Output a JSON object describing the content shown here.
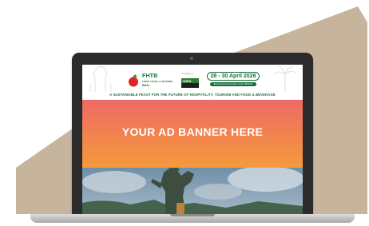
{
  "colors": {
    "background_shape": "#c7b49c",
    "laptop_frame": "#2b2b2d",
    "brand_green": "#1a6e3b",
    "ad_top": "#ee6a66",
    "ad_bottom": "#f59a3c"
  },
  "event_header": {
    "logo": {
      "name": "FHTB",
      "subtitle": "FOOD, HOTEL & TOURISM",
      "city": "BALI"
    },
    "partner": {
      "label": "ORGANISED BY",
      "mark": "WIRA"
    },
    "dates": "28 - 30 April 2026",
    "venue": "Bali Nusa Dua Convention Center (BNDCC)",
    "tagline": "A SUSTAINABLE FEAST FOR THE FUTURE OF HOSPITALITY, TOURISM AND FOOD & BEVERAGE"
  },
  "ad_banner": {
    "text": "YOUR AD BANNER HERE"
  },
  "hero": {
    "icon": "statue-photo"
  }
}
